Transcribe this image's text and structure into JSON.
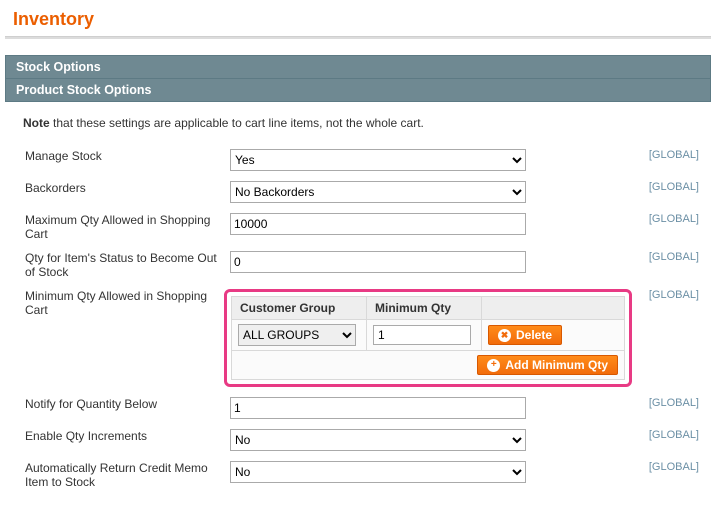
{
  "page_title": "Inventory",
  "sections": {
    "stock_options": "Stock Options",
    "product_stock_options": "Product Stock Options"
  },
  "note_bold": "Note",
  "note_rest": " that these settings are applicable to cart line items, not the whole cart.",
  "scope_label": "[GLOBAL]",
  "fields": {
    "manage_stock": {
      "label": "Manage Stock",
      "value": "Yes"
    },
    "backorders": {
      "label": "Backorders",
      "value": "No Backorders"
    },
    "max_qty": {
      "label": "Maximum Qty Allowed in Shopping Cart",
      "value": "10000"
    },
    "out_of_stock_qty": {
      "label": "Qty for Item's Status to Become Out of Stock",
      "value": "0"
    },
    "min_qty": {
      "label": "Minimum Qty Allowed in Shopping Cart"
    },
    "notify_qty": {
      "label": "Notify for Quantity Below",
      "value": "1"
    },
    "enable_increments": {
      "label": "Enable Qty Increments",
      "value": "No"
    },
    "auto_return": {
      "label": "Automatically Return Credit Memo Item to Stock",
      "value": "No"
    }
  },
  "min_qty_grid": {
    "headers": {
      "group": "Customer Group",
      "qty": "Minimum Qty"
    },
    "row": {
      "group": "ALL GROUPS",
      "qty": "1"
    },
    "buttons": {
      "delete": "Delete",
      "add": "Add Minimum Qty"
    }
  }
}
